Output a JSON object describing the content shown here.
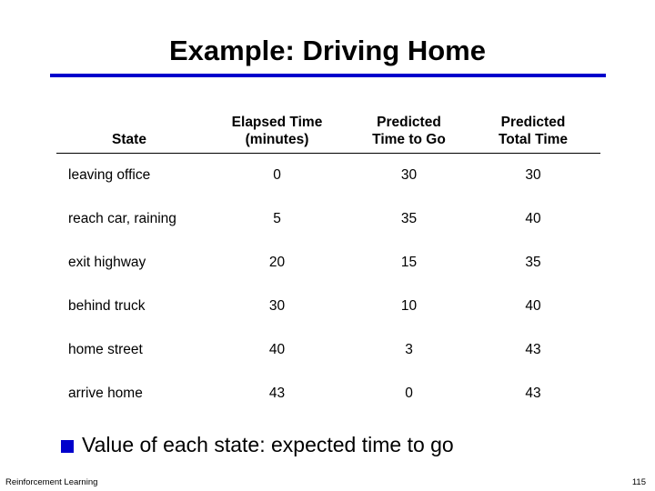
{
  "slide": {
    "title": "Example: Driving Home",
    "accent_color": "#0000cc"
  },
  "table": {
    "headers": [
      {
        "line1": "State",
        "line2": ""
      },
      {
        "line1": "Elapsed Time",
        "line2": "(minutes)"
      },
      {
        "line1": "Predicted",
        "line2": "Time to Go"
      },
      {
        "line1": "Predicted",
        "line2": "Total Time"
      }
    ],
    "rows": [
      [
        "leaving office",
        "0",
        "30",
        "30"
      ],
      [
        "reach car, raining",
        "5",
        "35",
        "40"
      ],
      [
        "exit highway",
        "20",
        "15",
        "35"
      ],
      [
        "behind truck",
        "30",
        "10",
        "40"
      ],
      [
        "home street",
        "40",
        "3",
        "43"
      ],
      [
        "arrive home",
        "43",
        "0",
        "43"
      ]
    ]
  },
  "bullets": [
    "Value of each state: expected time to go"
  ],
  "footer": {
    "left": "Reinforcement Learning",
    "page_number": "115"
  }
}
